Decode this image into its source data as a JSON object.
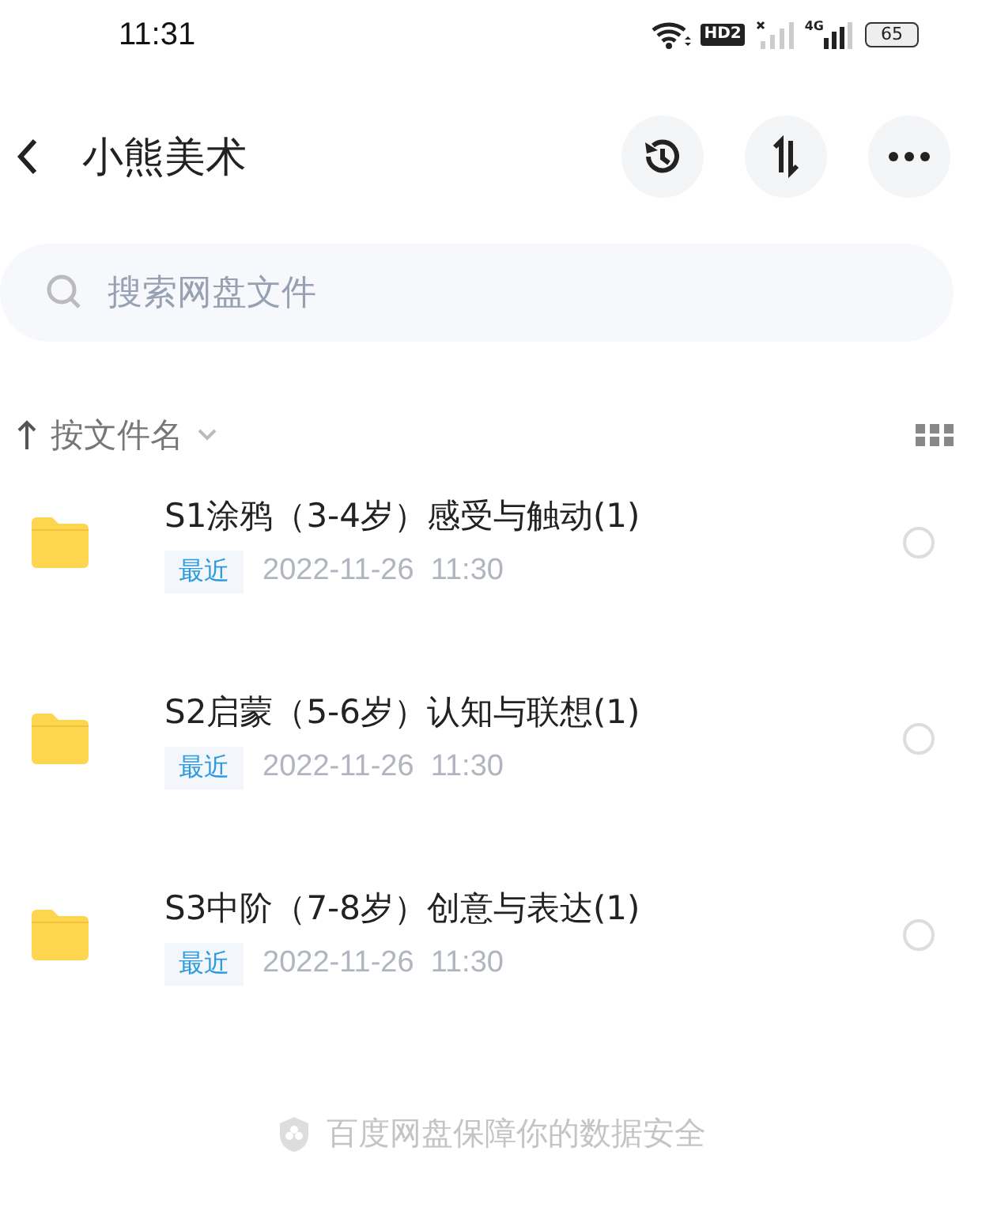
{
  "status_bar": {
    "time": "11:31",
    "hd_badge": "HD2",
    "network": "4G",
    "battery": "65"
  },
  "header": {
    "title": "小熊美术"
  },
  "search": {
    "placeholder": "搜索网盘文件"
  },
  "sort": {
    "label": "按文件名"
  },
  "files": [
    {
      "name": "S1涂鸦（3-4岁）感受与触动(1)",
      "tag": "最近",
      "date": "2022-11-26  11:30",
      "selected": false
    },
    {
      "name": "S2启蒙（5-6岁）认知与联想(1)",
      "tag": "最近",
      "date": "2022-11-26  11:30",
      "selected": false
    },
    {
      "name": "S3中阶（7-8岁）创意与表达(1)",
      "tag": "最近",
      "date": "2022-11-26  11:30",
      "selected": false
    }
  ],
  "footer": {
    "text": "百度网盘保障你的数据安全"
  }
}
